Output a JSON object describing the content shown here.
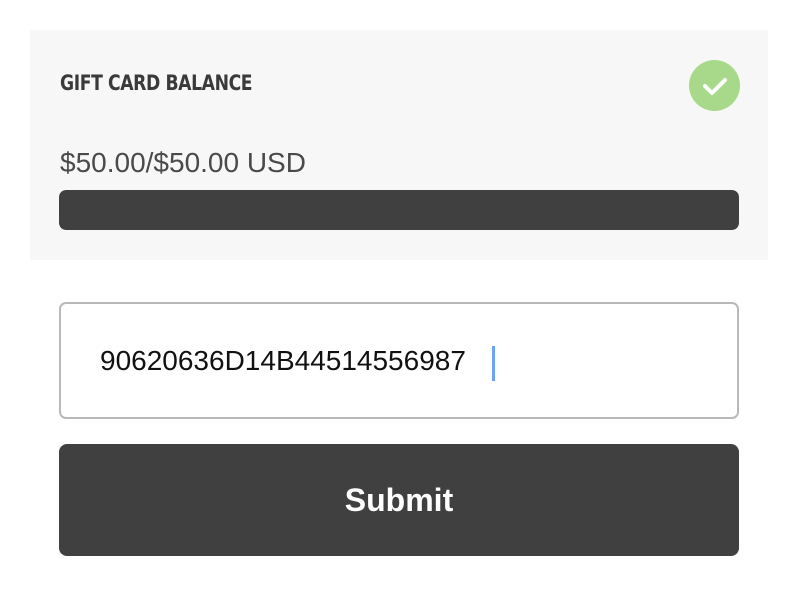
{
  "balance_panel": {
    "title": "GIFT CARD BALANCE",
    "balance_text": "$50.00/$50.00 USD",
    "remaining_fraction": 1.0,
    "status": "check-icon",
    "colors": {
      "panel_bg": "#f7f7f7",
      "check_badge": "#a8d98a",
      "progress_fill": "#404040"
    }
  },
  "code_input": {
    "value": "90620636D14B44514556987",
    "placeholder": ""
  },
  "submit": {
    "label": "Submit",
    "color": "#404040"
  }
}
